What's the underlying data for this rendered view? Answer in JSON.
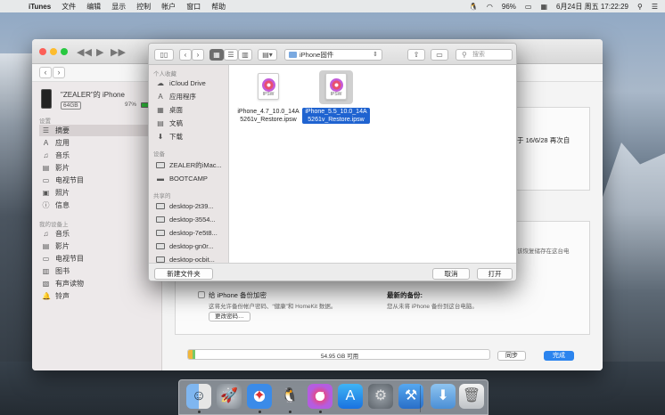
{
  "menubar": {
    "items": [
      "iTunes",
      "文件",
      "编辑",
      "显示",
      "控制",
      "帐户",
      "窗口",
      "帮助"
    ],
    "battery": "96%",
    "datetime": "6月24日 周五  17:22:29"
  },
  "itunes": {
    "device": {
      "name": "\"ZEALER\"的 iPhone",
      "capacity": "64GB",
      "battery_pct": "97%"
    },
    "sidebar": {
      "settings_header": "设置",
      "settings_items": [
        "摘要",
        "应用",
        "音乐",
        "影片",
        "电视节目",
        "照片",
        "信息"
      ],
      "device_header": "我的设备上",
      "device_items": [
        "音乐",
        "影片",
        "电视节目",
        "图书",
        "有声读物",
        "铃声"
      ]
    },
    "main": {
      "check_text": "于 16/6/28 再次自",
      "backup_restore_text": "该恢复储存在这台电",
      "encrypt_label": "给 iPhone 备份加密",
      "encrypt_desc": "这将允许备份帐户密码、“健康”和 HomeKit 数据。",
      "change_password": "更改密码…",
      "latest_backup_title": "最新的备份:",
      "latest_backup_desc": "您从未将 iPhone 备份到这台电脑。",
      "storage_label": "54.95 GB 可用",
      "sync_button": "同步",
      "done_button": "完成"
    }
  },
  "dialog": {
    "location": "iPhone固件",
    "search_placeholder": "搜索",
    "sidebar": {
      "favorites_header": "个人收藏",
      "favorites": [
        {
          "label": "iCloud Drive",
          "icon": "cloud-icon"
        },
        {
          "label": "应用程序",
          "icon": "applications-icon"
        },
        {
          "label": "桌面",
          "icon": "desktop-icon"
        },
        {
          "label": "文稿",
          "icon": "documents-icon"
        },
        {
          "label": "下载",
          "icon": "downloads-icon"
        }
      ],
      "devices_header": "设备",
      "devices": [
        {
          "label": "ZEALER的iMac...",
          "icon": "computer-icon"
        },
        {
          "label": "BOOTCAMP",
          "icon": "disk-icon"
        }
      ],
      "shared_header": "共享的",
      "shared": [
        {
          "label": "desktop-2t39...",
          "icon": "monitor-icon"
        },
        {
          "label": "desktop-3554...",
          "icon": "monitor-icon"
        },
        {
          "label": "desktop-7e5t8...",
          "icon": "monitor-icon"
        },
        {
          "label": "desktop-gn0r...",
          "icon": "monitor-icon"
        },
        {
          "label": "desktop-ocbit...",
          "icon": "monitor-icon"
        }
      ]
    },
    "files": [
      {
        "name": "iPhone_4.7_10.0_14A5261v_Restore.ipsw",
        "ext": "IPSW",
        "selected": false
      },
      {
        "name": "iPhone_5.5_10.0_14A5261v_Restore.ipsw",
        "ext": "IPSW",
        "selected": true
      }
    ],
    "new_folder_button": "新建文件夹",
    "cancel_button": "取消",
    "open_button": "打开"
  },
  "dock": {
    "apps": [
      "Finder",
      "Launchpad",
      "Safari",
      "QQ",
      "iTunes",
      "App Store",
      "System Preferences",
      "Xcode",
      "Downloads",
      "Trash"
    ]
  }
}
